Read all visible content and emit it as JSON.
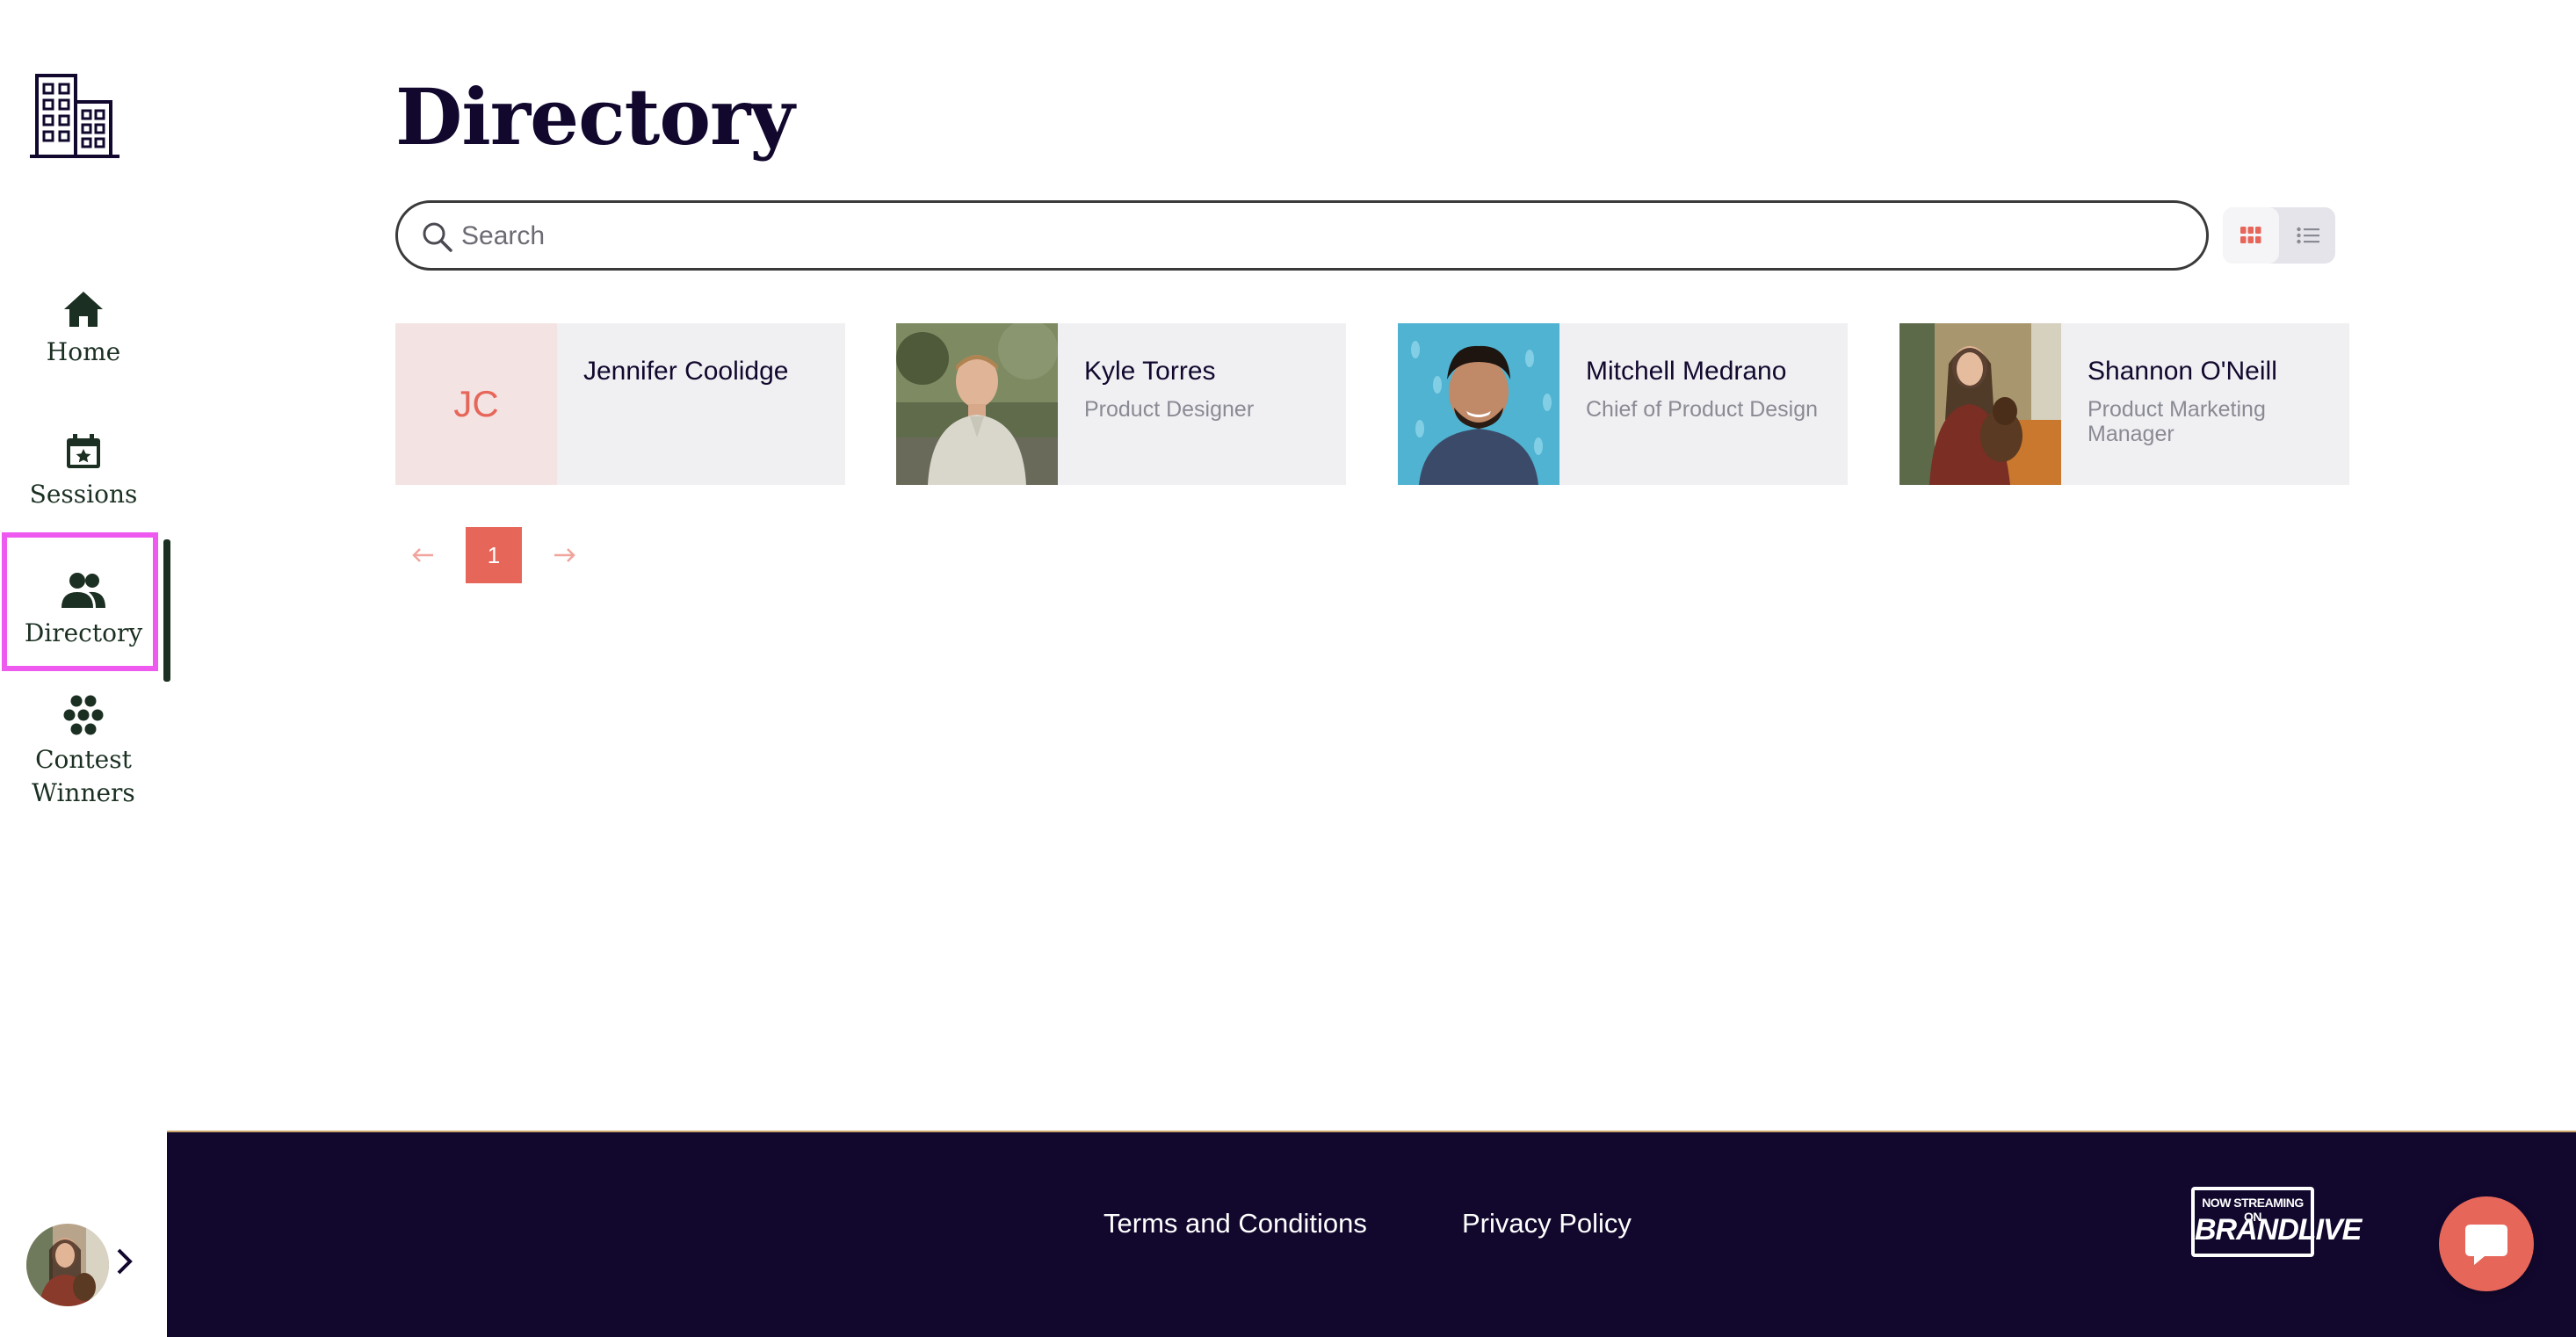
{
  "sidebar": {
    "logo_icon": "buildings-icon",
    "items": [
      {
        "label": "Home",
        "icon": "home-icon"
      },
      {
        "label": "Sessions",
        "icon": "calendar-star-icon"
      },
      {
        "label": "Directory",
        "icon": "people-icon",
        "active": true
      },
      {
        "label": "Contest Winners",
        "icon": "dots-cluster-icon"
      }
    ],
    "profile": {
      "icon": "chevron-right-icon"
    }
  },
  "main": {
    "title": "Directory",
    "search": {
      "placeholder": "Search",
      "value": ""
    },
    "view_toggle": {
      "selected": "grid",
      "options": [
        "grid",
        "list"
      ]
    },
    "people": [
      {
        "name": "Jennifer Coolidge",
        "role": "",
        "initials": "JC"
      },
      {
        "name": "Kyle Torres",
        "role": "Product Designer"
      },
      {
        "name": "Mitchell Medrano",
        "role": "Chief of Product Design"
      },
      {
        "name": "Shannon O'Neill",
        "role": "Product Marketing Manager"
      }
    ],
    "pagination": {
      "current_page": "1"
    }
  },
  "footer": {
    "links": [
      "Terms and Conditions",
      "Privacy Policy"
    ],
    "badge_top": "NOW STREAMING ON",
    "badge_brand": "BRANDLIVE"
  },
  "colors": {
    "accent": "#e7665a",
    "footer_bg": "#12082e",
    "nav_text": "#1b3022",
    "highlight": "#ee5af0",
    "card_bg": "#f0f0f3"
  }
}
